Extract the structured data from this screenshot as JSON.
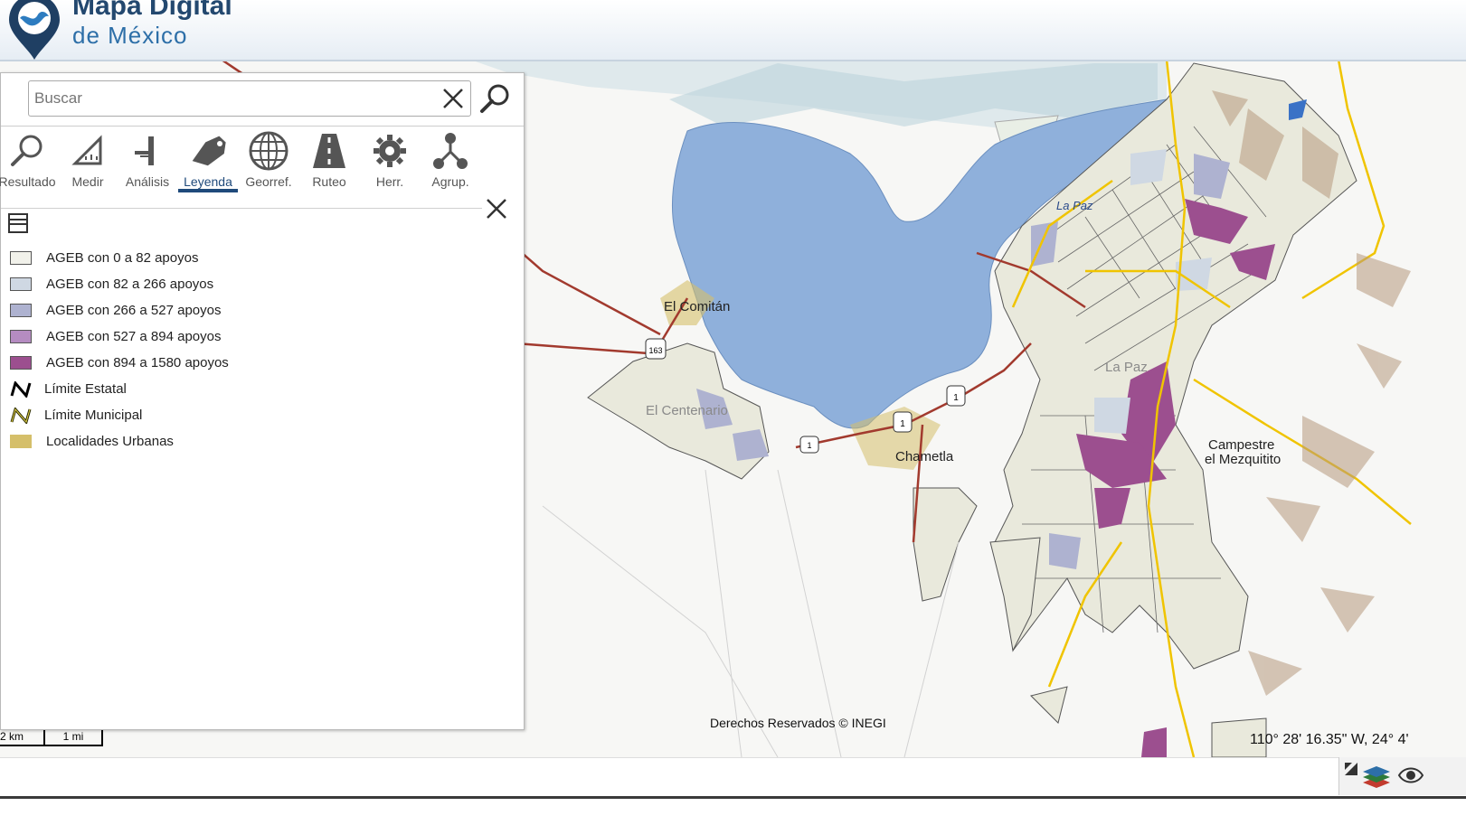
{
  "header": {
    "title": "Mapa Digital",
    "subtitle": "de México"
  },
  "search": {
    "placeholder": "Buscar",
    "value": "Buscar"
  },
  "toolbar": [
    {
      "label": "Resultado",
      "icon": "magnifier-icon"
    },
    {
      "label": "Medir",
      "icon": "ruler-icon"
    },
    {
      "label": "Análisis",
      "icon": "analysis-icon"
    },
    {
      "label": "Leyenda",
      "icon": "legend-tag-icon",
      "active": true
    },
    {
      "label": "Georref.",
      "icon": "globe-icon"
    },
    {
      "label": "Ruteo",
      "icon": "road-icon"
    },
    {
      "label": "Herr.",
      "icon": "gear-icon"
    },
    {
      "label": "Agrup.",
      "icon": "group-icon"
    }
  ],
  "legend": [
    {
      "label": "AGEB con 0 a 82 apoyos",
      "color": "#f1f1ea"
    },
    {
      "label": "AGEB con 82 a 266 apoyos",
      "color": "#cfd8e3"
    },
    {
      "label": "AGEB con 266 a 527 apoyos",
      "color": "#aeb2d0"
    },
    {
      "label": "AGEB con 527 a 894 apoyos",
      "color": "#b58cc1"
    },
    {
      "label": "AGEB con 894 a 1580 apoyos",
      "color": "#9c4f8f"
    },
    {
      "label": "Límite Estatal",
      "line_color": "#000000"
    },
    {
      "label": "Límite Municipal",
      "line_color": "#2b2b00"
    },
    {
      "label": "Localidades Urbanas",
      "color": "#d5bf6a"
    }
  ],
  "map": {
    "labels": {
      "el_comitan": "El Comitán",
      "el_centenario": "El Centenario",
      "chametla": "Chametla",
      "la_paz": "La Paz",
      "la_paz_bay": "La Paz",
      "campestre": "Campestre",
      "mezquitito": "el Mezquitito"
    },
    "highway_shields": [
      "163",
      "1",
      "1",
      "1"
    ],
    "colors": {
      "water": "#8fb0db",
      "road": "#a23a2e",
      "highway": "#f0c400"
    }
  },
  "scale": {
    "km": "2 km",
    "mi": "1 mi"
  },
  "copyright": "Derechos Reservados © INEGI",
  "coords": "110° 28' 16.35\" W, 24° 4'"
}
